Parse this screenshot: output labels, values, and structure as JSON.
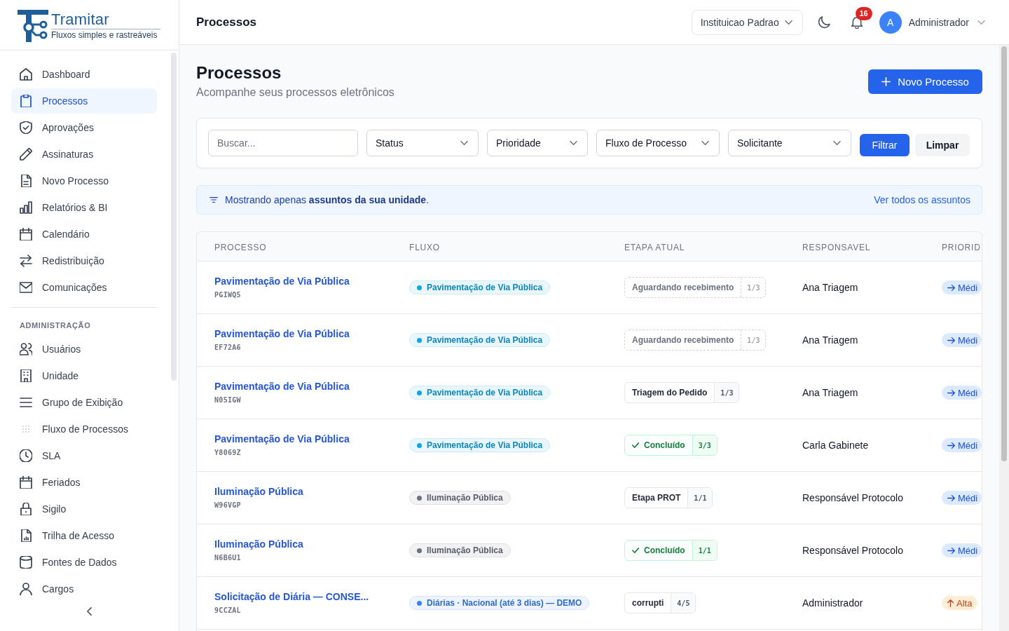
{
  "logo": {
    "name": "Tramitar",
    "tagline": "Fluxos simples e rastreáveis"
  },
  "sidebar": {
    "sections": [
      {
        "items": [
          {
            "label": "Dashboard",
            "selected": false
          },
          {
            "label": "Processos",
            "selected": true
          },
          {
            "label": "Aprovações",
            "selected": false
          },
          {
            "label": "Assinaturas",
            "selected": false
          },
          {
            "label": "Novo Processo",
            "selected": false
          },
          {
            "label": "Relatórios & BI",
            "selected": false
          },
          {
            "label": "Calendário",
            "selected": false
          },
          {
            "label": "Redistribuição",
            "selected": false
          },
          {
            "label": "Comunicações",
            "selected": false
          }
        ]
      },
      {
        "heading": "ADMINISTRAÇÃO",
        "items": [
          {
            "label": "Usuários",
            "selected": false
          },
          {
            "label": "Unidade",
            "selected": false
          },
          {
            "label": "Grupo de Exibição",
            "selected": false
          },
          {
            "label": "Fluxo de Processos",
            "selected": false
          },
          {
            "label": "SLA",
            "selected": false
          },
          {
            "label": "Feriados",
            "selected": false
          },
          {
            "label": "Sigilo",
            "selected": false
          },
          {
            "label": "Trilha de Acesso",
            "selected": false
          },
          {
            "label": "Fontes de Dados",
            "selected": false
          },
          {
            "label": "Cargos",
            "selected": false
          }
        ]
      }
    ]
  },
  "top_bar": {
    "title": "Processos",
    "institution": "Instituicao Padrao",
    "notification_count": "16",
    "user": {
      "initial": "A",
      "name": "Administrador"
    }
  },
  "page_header": {
    "title": "Processos",
    "subtitle": "Acompanhe seus processos eletrônicos",
    "action": "Novo Processo"
  },
  "filters": {
    "search": {
      "placeholder": "Buscar..."
    },
    "selects": [
      "Status",
      "Prioridade",
      "Fluxo de Processo",
      "Solicitante"
    ],
    "buttons": [
      {
        "label": "Filtrar",
        "kind": "primary"
      },
      {
        "label": "Limpar",
        "kind": "secondary"
      }
    ]
  },
  "notice": {
    "text": "Mostrando apenas **assuntos da sua unidade**.",
    "link": "Ver todos os assuntos"
  },
  "table": {
    "columns": [
      "PROCESSO",
      "FLUXO",
      "ETAPA ATUAL",
      "RESPONSAVEL",
      "PRIORID"
    ],
    "rows": [
      {
        "name": "Pavimentação de Via Pública",
        "code": "PGIWQ5",
        "flow": {
          "label": "Pavimentação de Via Pública",
          "color": "#0ea5e9"
        },
        "step": {
          "label": "Aguardando recebimento",
          "count": "1/3",
          "kind": "pending"
        },
        "assignee": "Ana Triagem",
        "priority": {
          "label": "Médi",
          "kind": "medium"
        }
      },
      {
        "name": "Pavimentação de Via Pública",
        "code": "EF72A6",
        "flow": {
          "label": "Pavimentação de Via Pública",
          "color": "#0ea5e9"
        },
        "step": {
          "label": "Aguardando recebimento",
          "count": "1/3",
          "kind": "pending"
        },
        "assignee": "Ana Triagem",
        "priority": {
          "label": "Médi",
          "kind": "medium"
        }
      },
      {
        "name": "Pavimentação de Via Pública",
        "code": "N05IGW",
        "flow": {
          "label": "Pavimentação de Via Pública",
          "color": "#0ea5e9"
        },
        "step": {
          "label": "Triagem do Pedido",
          "count": "1/3",
          "kind": "active"
        },
        "assignee": "Ana Triagem",
        "priority": {
          "label": "Médi",
          "kind": "medium"
        }
      },
      {
        "name": "Pavimentação de Via Pública",
        "code": "Y8069Z",
        "flow": {
          "label": "Pavimentação de Via Pública",
          "color": "#0ea5e9"
        },
        "step": {
          "label": "Concluído",
          "count": "3/3",
          "kind": "done"
        },
        "assignee": "Carla Gabinete",
        "priority": {
          "label": "Médi",
          "kind": "medium"
        }
      },
      {
        "name": "Iluminação Pública",
        "code": "W96VGP",
        "flow": {
          "label": "Iluminação Pública",
          "color": "#6b7280"
        },
        "step": {
          "label": "Etapa PROT",
          "count": "1/1",
          "kind": "active"
        },
        "assignee": "Responsável Protocolo",
        "priority": {
          "label": "Médi",
          "kind": "medium"
        }
      },
      {
        "name": "Iluminação Pública",
        "code": "N6B6U1",
        "flow": {
          "label": "Iluminação Pública",
          "color": "#6b7280"
        },
        "step": {
          "label": "Concluído",
          "count": "1/1",
          "kind": "done"
        },
        "assignee": "Responsável Protocolo",
        "priority": {
          "label": "Médi",
          "kind": "medium"
        }
      },
      {
        "name": "Solicitação de Diária — CONSE...",
        "code": "9CCZAL",
        "flow": {
          "label": "Diárias · Nacional (até 3 dias) — DEMO",
          "color": "#3b82f6"
        },
        "step": {
          "label": "corrupti",
          "count": "4/5",
          "kind": "active"
        },
        "assignee": "Administrador",
        "priority": {
          "label": "Alta",
          "kind": "high"
        }
      }
    ]
  }
}
